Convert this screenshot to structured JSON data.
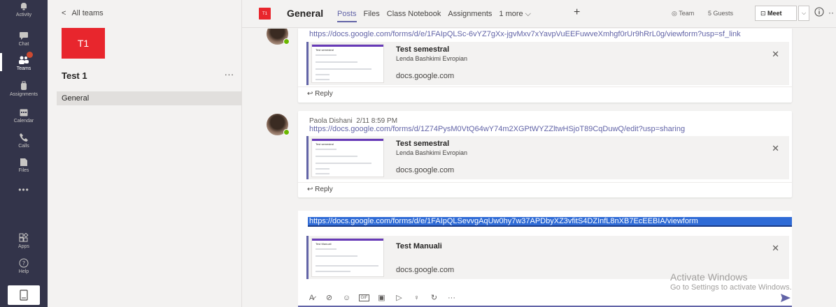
{
  "rail": {
    "items": [
      {
        "label": "Activity",
        "icon": "bell-icon"
      },
      {
        "label": "Chat",
        "icon": "chat-icon"
      },
      {
        "label": "Teams",
        "icon": "teams-icon"
      },
      {
        "label": "Assignments",
        "icon": "backpack-icon"
      },
      {
        "label": "Calendar",
        "icon": "calendar-icon"
      },
      {
        "label": "Calls",
        "icon": "phone-icon"
      },
      {
        "label": "Files",
        "icon": "files-icon"
      },
      {
        "label": "Apps",
        "icon": "apps-icon"
      },
      {
        "label": "Help",
        "icon": "help-icon"
      }
    ]
  },
  "team_panel": {
    "back_label": "All teams",
    "team_avatar_text": "T1",
    "team_name": "Test 1",
    "more": "...",
    "channel": "General"
  },
  "header": {
    "avatar_text": "T1",
    "title": "General",
    "tabs": [
      "Posts",
      "Files",
      "Class Notebook",
      "Assignments",
      "1 more ⌵"
    ],
    "team_label": "Team",
    "guests_label": "5 Guests",
    "meet_label": "Meet"
  },
  "messages": [
    {
      "author": "",
      "link": "https://docs.google.com/forms/d/e/1FAIpQLSc-6vYZ7gXx-jgvMxv7xYavpVuEEFuwveXmhgf0rUr9hRrL0g/viewform?usp=sf_link",
      "preview_title": "Test semestral",
      "preview_subtitle": "Lenda Bashkimi Evropian",
      "preview_domain": "docs.google.com",
      "reply": "Reply"
    },
    {
      "author": "Paola Dishani",
      "timestamp": "2/11 8:59 PM",
      "link": "https://docs.google.com/forms/d/1Z74PysM0VtQ64wY74m2XGPtWYZZltwHSjoT89CqDuwQ/edit?usp=sharing",
      "preview_title": "Test semestral",
      "preview_subtitle": "Lenda Bashkimi Evropian",
      "preview_domain": "docs.google.com",
      "reply": "Reply"
    }
  ],
  "compose": {
    "link": "https://docs.google.com/forms/d/e/1FAIpQLSevvgAqUw0hy7w37APDbyXZ3vfitS4DZInfL8nXB7EcEEBIA/viewform",
    "preview_title": "Test Manuali",
    "preview_domain": "docs.google.com"
  },
  "watermark": {
    "line1": "Activate Windows",
    "line2": "Go to Settings to activate Windows."
  },
  "colors": {
    "accent": "#6264a7",
    "rail": "#33344a",
    "team_red": "#e8262d",
    "presence": "#6bb700"
  }
}
